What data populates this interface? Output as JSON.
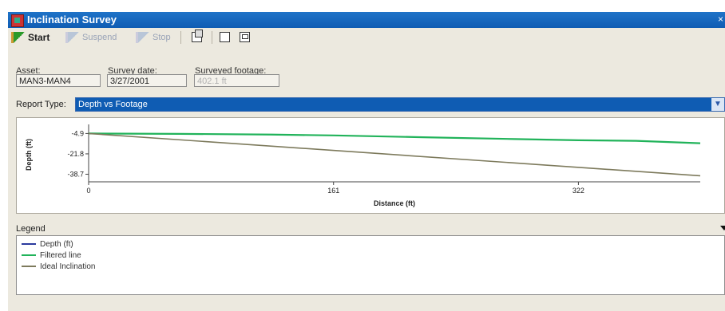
{
  "window": {
    "title": "Inclination Survey",
    "close_glyph": "×"
  },
  "toolbar": {
    "start": "Start",
    "suspend": "Suspend",
    "stop": "Stop"
  },
  "fields": {
    "asset_label": "Asset:",
    "asset_value": "MAN3-MAN4",
    "date_label": "Survey date:",
    "date_value": "3/27/2001",
    "footage_label": "Surveyed footage:",
    "footage_value": "402.1 ft"
  },
  "report": {
    "label": "Report Type:",
    "value": "Depth vs Footage"
  },
  "legend": {
    "title": "Legend",
    "items": [
      {
        "label": "Depth (ft)",
        "color": "#2b3a9e"
      },
      {
        "label": "Filtered line",
        "color": "#21b35a"
      },
      {
        "label": "Ideal Inclination",
        "color": "#7d7a5c"
      }
    ]
  },
  "chart_data": {
    "type": "line",
    "xlabel": "Distance (ft)",
    "ylabel": "Depth (ft)",
    "x_ticks": [
      0,
      161,
      322
    ],
    "y_ticks": [
      -4.9,
      -21.8,
      -38.7
    ],
    "xlim": [
      0,
      402.1
    ],
    "ylim": [
      -45,
      0
    ],
    "series": [
      {
        "name": "Filtered line",
        "color": "#21b35a",
        "points": [
          [
            0,
            -4.9
          ],
          [
            60,
            -5.2
          ],
          [
            120,
            -5.8
          ],
          [
            161,
            -6.5
          ],
          [
            220,
            -8
          ],
          [
            280,
            -9.5
          ],
          [
            322,
            -10.5
          ],
          [
            360,
            -11
          ],
          [
            402.1,
            -13
          ]
        ]
      },
      {
        "name": "Ideal Inclination",
        "color": "#7d7a5c",
        "points": [
          [
            0,
            -4.9
          ],
          [
            402.1,
            -40
          ]
        ]
      }
    ]
  }
}
